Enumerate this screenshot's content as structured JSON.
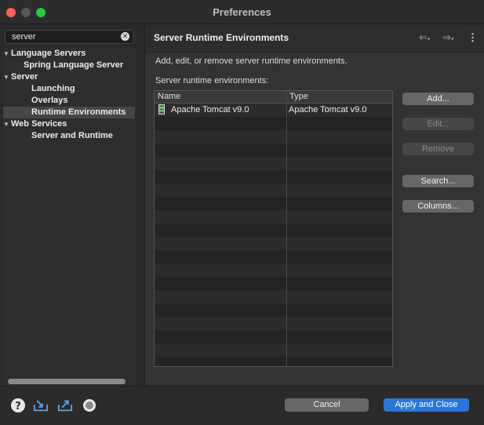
{
  "window": {
    "title": "Preferences"
  },
  "colors": {
    "close": "#ff5f57",
    "minimize": "#2e2e2e",
    "zoom": "#28c840",
    "accent": "#2b77d8"
  },
  "filter": {
    "value": "server"
  },
  "tree": [
    {
      "label": "Language Servers",
      "level": 0,
      "expanded": true
    },
    {
      "label": "Spring Language Server",
      "level": 1
    },
    {
      "label": "Server",
      "level": 0,
      "expanded": true
    },
    {
      "label": "Launching",
      "level": 1
    },
    {
      "label": "Overlays",
      "level": 1
    },
    {
      "label": "Runtime Environments",
      "level": 1,
      "selected": true
    },
    {
      "label": "Web Services",
      "level": 0,
      "expanded": true
    },
    {
      "label": "Server and Runtime",
      "level": 1
    }
  ],
  "page": {
    "title": "Server Runtime Environments",
    "description": "Add, edit, or remove server runtime environments.",
    "table_label": "Server runtime environments:",
    "columns": [
      "Name",
      "Type"
    ],
    "rows": [
      {
        "name": "Apache Tomcat v9.0",
        "type": "Apache Tomcat v9.0",
        "icon": "tomcat-server-icon"
      }
    ]
  },
  "buttons": {
    "add": "Add...",
    "edit": "Edit...",
    "remove": "Remove",
    "search": "Search...",
    "columns": "Columns...",
    "edit_enabled": false,
    "remove_enabled": false
  },
  "footer": {
    "cancel": "Cancel",
    "apply_close": "Apply and Close",
    "icons": [
      "help-icon",
      "import-icon",
      "export-icon",
      "record-icon"
    ]
  }
}
